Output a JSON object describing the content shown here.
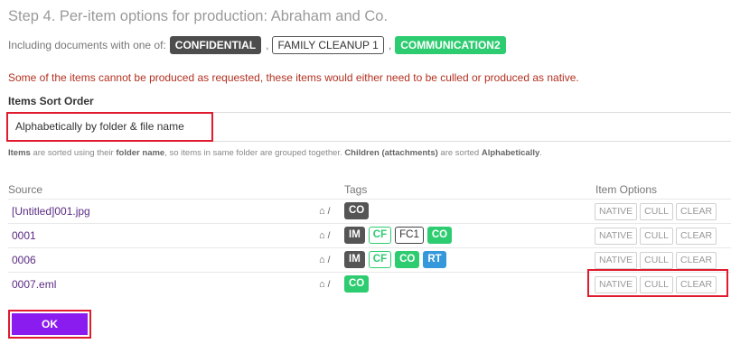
{
  "title": "Step 4. Per-item options for production: Abraham and Co.",
  "including": {
    "label": "Including documents with one of:",
    "tags": [
      {
        "text": "CONFIDENTIAL",
        "style": "dark"
      },
      {
        "text": "FAMILY CLEANUP 1",
        "style": "outline"
      },
      {
        "text": "COMMUNICATION2",
        "style": "green"
      }
    ]
  },
  "warning": "Some of the items cannot be produced as requested, these items would either need to be culled or produced as native.",
  "sort": {
    "label": "Items Sort Order",
    "value": "Alphabetically by folder & file name"
  },
  "help": {
    "p1": "Items",
    "p2": " are sorted using their ",
    "p3": "folder name",
    "p4": ", so items in same folder are grouped together. ",
    "p5": "Children (attachments)",
    "p6": " are sorted ",
    "p7": "Alphabetically",
    "p8": "."
  },
  "table": {
    "headers": {
      "source": "Source",
      "tags": "Tags",
      "options": "Item Options"
    },
    "path_text": "/",
    "option_labels": {
      "native": "NATIVE",
      "cull": "CULL",
      "clear": "CLEAR"
    },
    "rows": [
      {
        "source": "[Untitled]001.jpg",
        "tags": [
          {
            "text": "CO",
            "style": "dark"
          }
        ]
      },
      {
        "source": "0001",
        "tags": [
          {
            "text": "IM",
            "style": "dark"
          },
          {
            "text": "CF",
            "style": "gout"
          },
          {
            "text": "FC1",
            "style": "out"
          },
          {
            "text": "CO",
            "style": "green"
          }
        ]
      },
      {
        "source": "0006",
        "tags": [
          {
            "text": "IM",
            "style": "dark"
          },
          {
            "text": "CF",
            "style": "gout"
          },
          {
            "text": "CO",
            "style": "green"
          },
          {
            "text": "RT",
            "style": "blue"
          }
        ]
      },
      {
        "source": "0007.eml",
        "tags": [
          {
            "text": "CO",
            "style": "green"
          }
        ]
      }
    ]
  },
  "ok_label": "OK",
  "colors": {
    "accent": "#8b1cf0",
    "warning": "#b2301f",
    "highlight": "#e01b2f",
    "green": "#2ecc71",
    "blue": "#3498db"
  }
}
